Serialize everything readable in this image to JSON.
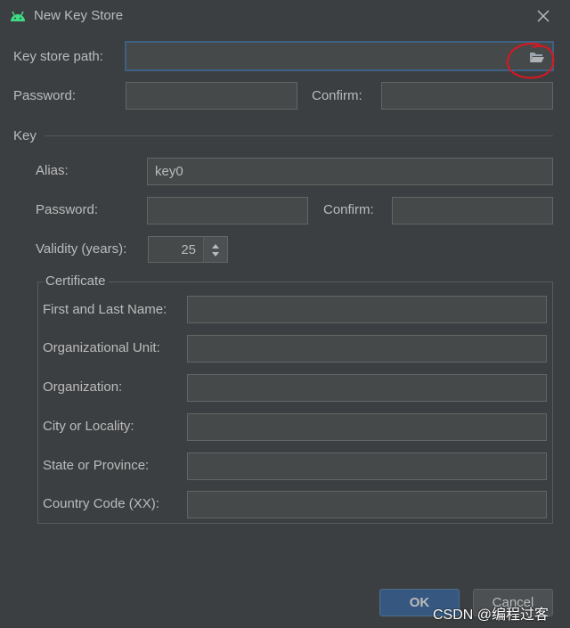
{
  "window": {
    "title": "New Key Store"
  },
  "keystore": {
    "path_label": "Key store path:",
    "path_value": "",
    "password_label": "Password:",
    "confirm_label": "Confirm:"
  },
  "key": {
    "section_label": "Key",
    "alias_label": "Alias:",
    "alias_value": "key0",
    "password_label": "Password:",
    "confirm_label": "Confirm:",
    "validity_label": "Validity (years):",
    "validity_value": "25"
  },
  "certificate": {
    "title": "Certificate",
    "fields": [
      {
        "label": "First and Last Name:",
        "value": ""
      },
      {
        "label": "Organizational Unit:",
        "value": ""
      },
      {
        "label": "Organization:",
        "value": ""
      },
      {
        "label": "City or Locality:",
        "value": ""
      },
      {
        "label": "State or Province:",
        "value": ""
      },
      {
        "label": "Country Code (XX):",
        "value": ""
      }
    ]
  },
  "buttons": {
    "ok": "OK",
    "cancel": "Cancel"
  },
  "watermark": "CSDN @编程过客",
  "icons": {
    "app": "android-icon",
    "close": "close-icon",
    "browse": "folder-open-icon",
    "spinner": "spinner-arrows-icon"
  },
  "colors": {
    "background": "#3c3f41",
    "field_bg": "#45494a",
    "focus_border": "#3d6185",
    "ok_button": "#365880",
    "android_green": "#3ddc84",
    "annotation_red": "#e0141e"
  }
}
